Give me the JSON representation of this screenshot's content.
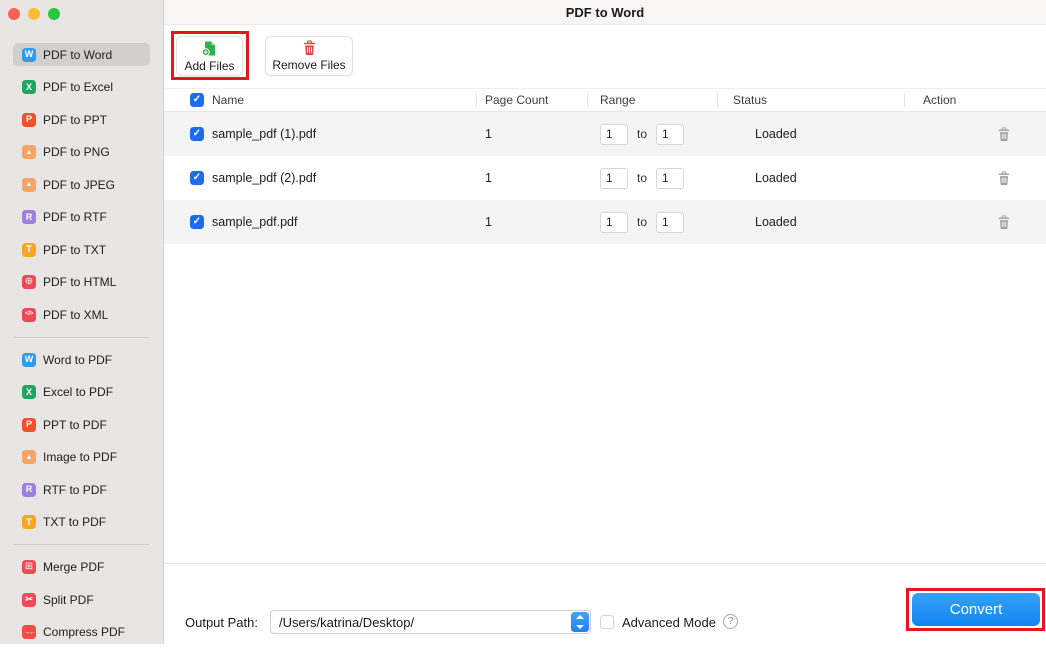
{
  "window": {
    "title": "PDF to Word"
  },
  "colors": {
    "annotation_red": "#e4181b",
    "accent_blue": "#1d96f8",
    "checkbox_blue": "#1c6ceb",
    "sidebar_bg": "#e7e6e4",
    "selected_item_bg": "#d1d0ce",
    "row_alt_bg": "#f4f4f5"
  },
  "icons": {
    "check": "✓",
    "help": "?"
  },
  "sidebar": {
    "items": [
      {
        "label": "PDF to Word",
        "glyph": "W",
        "color": "#2d9cf4",
        "selected": true
      },
      {
        "label": "PDF to Excel",
        "glyph": "X",
        "color": "#21a563",
        "selected": false
      },
      {
        "label": "PDF to PPT",
        "glyph": "P",
        "color": "#f4502c",
        "selected": false
      },
      {
        "label": "PDF to PNG",
        "glyph": "▲",
        "color": "#f6a464",
        "selected": false
      },
      {
        "label": "PDF to JPEG",
        "glyph": "▲",
        "color": "#f6a464",
        "selected": false
      },
      {
        "label": "PDF to RTF",
        "glyph": "R",
        "color": "#9d7fe0",
        "selected": false
      },
      {
        "label": "PDF to TXT",
        "glyph": "T",
        "color": "#f7a727",
        "selected": false
      },
      {
        "label": "PDF to HTML",
        "glyph": "⊕",
        "color": "#ee4956",
        "selected": false
      },
      {
        "label": "PDF to XML",
        "glyph": "</>",
        "color": "#ee4956",
        "selected": false
      },
      {
        "label": "Word to PDF",
        "glyph": "W",
        "color": "#2d9cf4",
        "selected": false
      },
      {
        "label": "Excel to PDF",
        "glyph": "X",
        "color": "#21a563",
        "selected": false
      },
      {
        "label": "PPT to PDF",
        "glyph": "P",
        "color": "#f4502c",
        "selected": false
      },
      {
        "label": "Image to PDF",
        "glyph": "▲",
        "color": "#f6a464",
        "selected": false
      },
      {
        "label": "RTF to PDF",
        "glyph": "R",
        "color": "#9d7fe0",
        "selected": false
      },
      {
        "label": "TXT to PDF",
        "glyph": "T",
        "color": "#f7a727",
        "selected": false
      },
      {
        "label": "Merge PDF",
        "glyph": "⊞",
        "color": "#ee4956",
        "selected": false
      },
      {
        "label": "Split PDF",
        "glyph": "✂",
        "color": "#ee4956",
        "selected": false
      },
      {
        "label": "Compress PDF",
        "glyph": "→←",
        "color": "#f64c45",
        "selected": false
      }
    ]
  },
  "toolbar": {
    "add_files_label": "Add Files",
    "remove_files_label": "Remove Files"
  },
  "table": {
    "headers": {
      "name": "Name",
      "page_count": "Page Count",
      "range": "Range",
      "status": "Status",
      "action": "Action"
    },
    "range_separator": "to",
    "rows": [
      {
        "name": "sample_pdf (1).pdf",
        "page_count": "1",
        "range_from": "1",
        "range_to": "1",
        "status": "Loaded",
        "checked": true
      },
      {
        "name": "sample_pdf (2).pdf",
        "page_count": "1",
        "range_from": "1",
        "range_to": "1",
        "status": "Loaded",
        "checked": true
      },
      {
        "name": "sample_pdf.pdf",
        "page_count": "1",
        "range_from": "1",
        "range_to": "1",
        "status": "Loaded",
        "checked": true
      }
    ]
  },
  "footer": {
    "output_path_label": "Output Path:",
    "output_path_value": "/Users/katrina/Desktop/",
    "advanced_mode_label": "Advanced Mode",
    "advanced_mode_checked": false,
    "convert_label": "Convert"
  }
}
